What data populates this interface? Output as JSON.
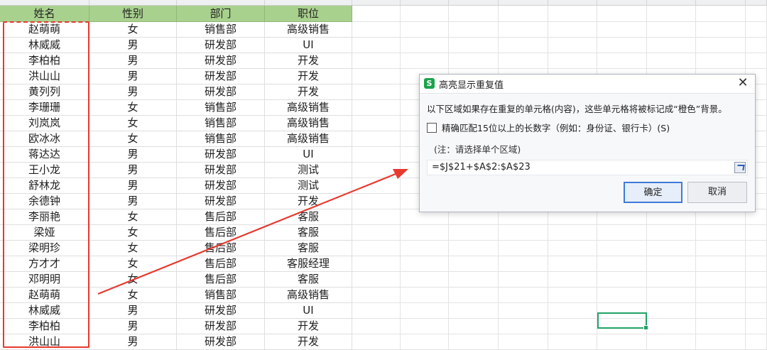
{
  "headers": [
    "姓名",
    "性别",
    "部门",
    "职位"
  ],
  "rows": [
    [
      "赵萌萌",
      "女",
      "销售部",
      "高级销售"
    ],
    [
      "林威威",
      "男",
      "研发部",
      "UI"
    ],
    [
      "李柏柏",
      "男",
      "研发部",
      "开发"
    ],
    [
      "洪山山",
      "男",
      "研发部",
      "开发"
    ],
    [
      "黄列列",
      "男",
      "研发部",
      "开发"
    ],
    [
      "李珊珊",
      "女",
      "销售部",
      "高级销售"
    ],
    [
      "刘岚岚",
      "女",
      "销售部",
      "高级销售"
    ],
    [
      "欧冰冰",
      "女",
      "销售部",
      "高级销售"
    ],
    [
      "蒋达达",
      "男",
      "研发部",
      "UI"
    ],
    [
      "王小龙",
      "男",
      "研发部",
      "测试"
    ],
    [
      "舒林龙",
      "男",
      "研发部",
      "测试"
    ],
    [
      "余德钟",
      "男",
      "研发部",
      "开发"
    ],
    [
      "李丽艳",
      "女",
      "售后部",
      "客服"
    ],
    [
      "梁娅",
      "女",
      "售后部",
      "客服"
    ],
    [
      "梁明珍",
      "女",
      "售后部",
      "客服"
    ],
    [
      "方才才",
      "女",
      "售后部",
      "客服经理"
    ],
    [
      "邓明明",
      "女",
      "售后部",
      "客服"
    ],
    [
      "赵萌萌",
      "女",
      "销售部",
      "高级销售"
    ],
    [
      "林威威",
      "男",
      "研发部",
      "UI"
    ],
    [
      "李柏柏",
      "男",
      "研发部",
      "开发"
    ],
    [
      "洪山山",
      "男",
      "研发部",
      "开发"
    ]
  ],
  "dialog": {
    "app_icon": "S",
    "title": "高亮显示重复值",
    "description": "以下区域如果存在重复的单元格(内容)，这些单元格将被标记成“橙色”背景。",
    "checkbox_label": "精确匹配15位以上的长数字（例如：身份证、银行卡）(S)",
    "checkbox_checked": false,
    "note": "(注：请选择单个区域)",
    "formula": "=$J$21+$A$2:$A$23",
    "ok_label": "确定",
    "cancel_label": "取消"
  },
  "colors": {
    "header_bg": "#a9d18e",
    "highlight_red": "#e8392f",
    "active_cell": "#21a366",
    "dialog_accent": "#3f7ad6"
  }
}
